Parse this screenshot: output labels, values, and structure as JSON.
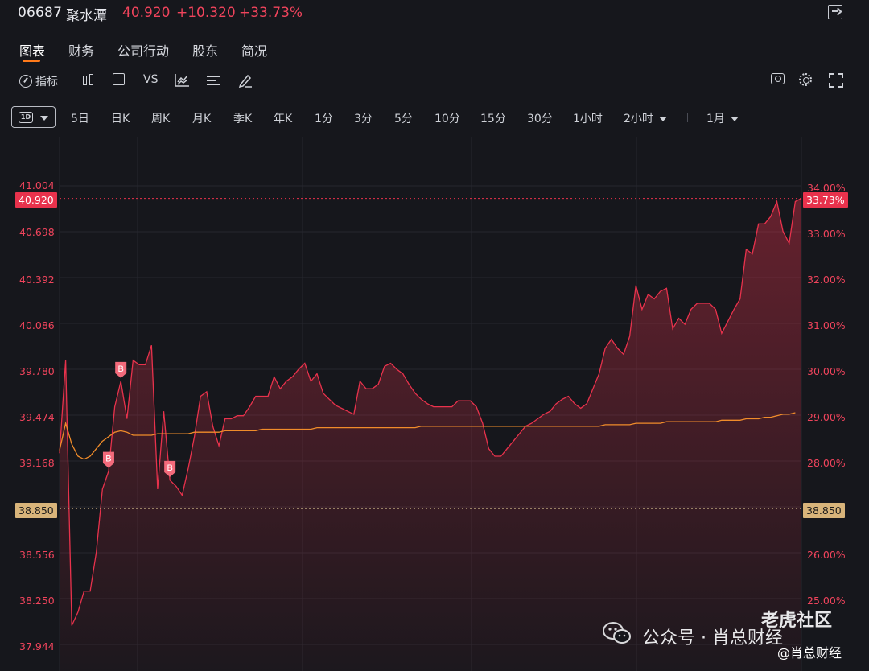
{
  "header": {
    "code": "06687",
    "name": "聚水潭",
    "price": "40.920",
    "change": "+10.320",
    "change_pct": "+33.73%",
    "exit_icon": "exit-fullscreen-icon"
  },
  "tabs": [
    {
      "label": "图表",
      "active": true
    },
    {
      "label": "财务"
    },
    {
      "label": "公司行动"
    },
    {
      "label": "股东"
    },
    {
      "label": "简况"
    }
  ],
  "toolbar": {
    "indicator_label": "指标",
    "vs_label": "VS",
    "icons": [
      "gauge-icon",
      "candlestick-icon",
      "square-icon",
      "compare-chart-icon",
      "lines-icon",
      "draw-pen-icon",
      "camera-icon",
      "gear-icon",
      "expand-icon"
    ]
  },
  "periods": {
    "selected_icon_label": "1D",
    "items": [
      "5日",
      "日K",
      "周K",
      "月K",
      "季K",
      "年K",
      "1分",
      "3分",
      "5分",
      "10分",
      "15分",
      "30分",
      "1小时",
      "2小时",
      "1月"
    ]
  },
  "axes": {
    "left_ticks": [
      "41.004",
      "40.698",
      "40.392",
      "40.086",
      "39.780",
      "39.474",
      "39.168",
      "38.556",
      "38.250",
      "37.944"
    ],
    "right_ticks": [
      "34.00%",
      "33.00%",
      "32.00%",
      "31.00%",
      "30.00%",
      "29.00%",
      "28.00%",
      "26.00%",
      "25.00%"
    ],
    "current_price_tag": "40.920",
    "current_pct_tag": "33.73%",
    "prev_close_tag_left": "38.850",
    "prev_close_tag_right": "38.850"
  },
  "markers": [
    "B",
    "B",
    "B"
  ],
  "watermark": {
    "public_account": "公众号 · 肖总财经",
    "community": "老虎社区",
    "handle": "@肖总财经"
  },
  "colors": {
    "price_line": "#e8324c",
    "avg_line": "#f08c2a",
    "up": "#f0445c",
    "tab_accent": "#ff7a1a",
    "prev_close": "#d8b47a"
  },
  "chart_data": {
    "type": "line",
    "series": [
      {
        "values": [
          39.22,
          39.84,
          38.07,
          38.16,
          38.3,
          38.3,
          38.56,
          38.98,
          39.1,
          39.53,
          39.7,
          39.45,
          39.84,
          39.81,
          39.81,
          39.94,
          38.98,
          39.5,
          39.04,
          39.0,
          38.94,
          39.12,
          39.33,
          39.6,
          39.63,
          39.4,
          39.27,
          39.45,
          39.45,
          39.47,
          39.47,
          39.53,
          39.6,
          39.6,
          39.6,
          39.73,
          39.65,
          39.7,
          39.73,
          39.78,
          39.82,
          39.7,
          39.75,
          39.62,
          39.58,
          39.54,
          39.52,
          39.5,
          39.48,
          39.7,
          39.65,
          39.65,
          39.68,
          39.8,
          39.82,
          39.78,
          39.75,
          39.68,
          39.62,
          39.58,
          39.55,
          39.53,
          39.53,
          39.53,
          39.53,
          39.57,
          39.57,
          39.57,
          39.53,
          39.42,
          39.25,
          39.2,
          39.2,
          39.25,
          39.3,
          39.35,
          39.4,
          39.42,
          39.45,
          39.48,
          39.5,
          39.55,
          39.58,
          39.6,
          39.55,
          39.52,
          39.55,
          39.65,
          39.75,
          39.92,
          39.98,
          39.92,
          39.88,
          40.0,
          40.34,
          40.18,
          40.28,
          40.25,
          40.3,
          40.32,
          40.05,
          40.12,
          40.08,
          40.18,
          40.22,
          40.22,
          40.22,
          40.18,
          40.02,
          40.1,
          40.18,
          40.25,
          40.58,
          40.55,
          40.75,
          40.75,
          40.8,
          40.9,
          40.7,
          40.62,
          40.9,
          40.92
        ]
      },
      {
        "values": [
          39.24,
          39.42,
          39.28,
          39.2,
          39.18,
          39.2,
          39.25,
          39.3,
          39.33,
          39.36,
          39.37,
          39.36,
          39.34,
          39.34,
          39.34,
          39.34,
          39.35,
          39.35,
          39.35,
          39.35,
          39.35,
          39.35,
          39.36,
          39.36,
          39.36,
          39.36,
          39.36,
          39.37,
          39.37,
          39.37,
          39.37,
          39.37,
          39.37,
          39.38,
          39.38,
          39.38,
          39.38,
          39.38,
          39.38,
          39.38,
          39.38,
          39.38,
          39.39,
          39.39,
          39.39,
          39.39,
          39.39,
          39.39,
          39.39,
          39.39,
          39.39,
          39.39,
          39.39,
          39.39,
          39.39,
          39.39,
          39.39,
          39.39,
          39.39,
          39.4,
          39.4,
          39.4,
          39.4,
          39.4,
          39.4,
          39.4,
          39.4,
          39.4,
          39.4,
          39.4,
          39.4,
          39.4,
          39.4,
          39.4,
          39.4,
          39.4,
          39.4,
          39.4,
          39.4,
          39.4,
          39.4,
          39.4,
          39.4,
          39.4,
          39.4,
          39.4,
          39.4,
          39.4,
          39.4,
          39.41,
          39.41,
          39.41,
          39.41,
          39.41,
          39.42,
          39.42,
          39.42,
          39.42,
          39.42,
          39.43,
          39.43,
          39.43,
          39.43,
          39.43,
          39.43,
          39.43,
          39.43,
          39.43,
          39.44,
          39.44,
          39.44,
          39.44,
          39.45,
          39.45,
          39.45,
          39.46,
          39.46,
          39.47,
          39.48,
          39.48,
          39.49
        ]
      }
    ],
    "ylim": [
      37.88,
      41.1
    ],
    "prev_close": 38.85,
    "markers": [
      {
        "index": 8,
        "value": 39.1,
        "label": "B"
      },
      {
        "index": 10,
        "value": 39.7,
        "label": "B"
      },
      {
        "index": 18,
        "value": 39.04,
        "label": "B"
      }
    ],
    "grid": true
  }
}
